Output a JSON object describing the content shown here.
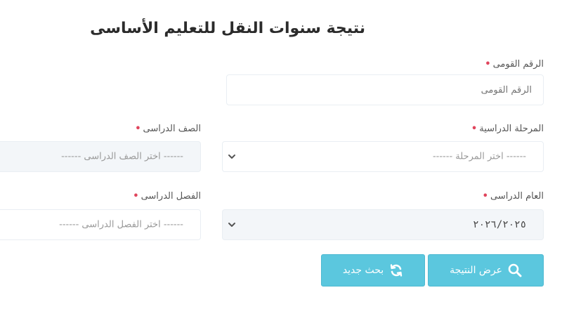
{
  "page": {
    "title": "نتيجة سنوات النقل للتعليم الأساسى"
  },
  "form": {
    "required_mark": "•",
    "national_id": {
      "label": "الرقم القومى",
      "placeholder": "الرقم القومى"
    },
    "stage": {
      "label": "المرحلة الدراسية",
      "selected": "------ اختر المرحلة ------"
    },
    "grade": {
      "label": "الصف الدراسى",
      "selected": "------ اختر الصف الدراسى ------"
    },
    "academic_year": {
      "label": "العام الدراسى",
      "selected": "٢٠٢٦/٢٠٢٥"
    },
    "term": {
      "label": "الفصل الدراسى",
      "selected": "------ اختر الفصل الدراسى ------"
    }
  },
  "actions": {
    "show_result": "عرض النتيجة",
    "new_search": "بحث جديد"
  },
  "colors": {
    "button": "#5bc7de",
    "required": "#e0455c"
  },
  "icons": {
    "show_result": "search-icon",
    "new_search": "refresh-icon",
    "select": "chevron-down-icon"
  }
}
